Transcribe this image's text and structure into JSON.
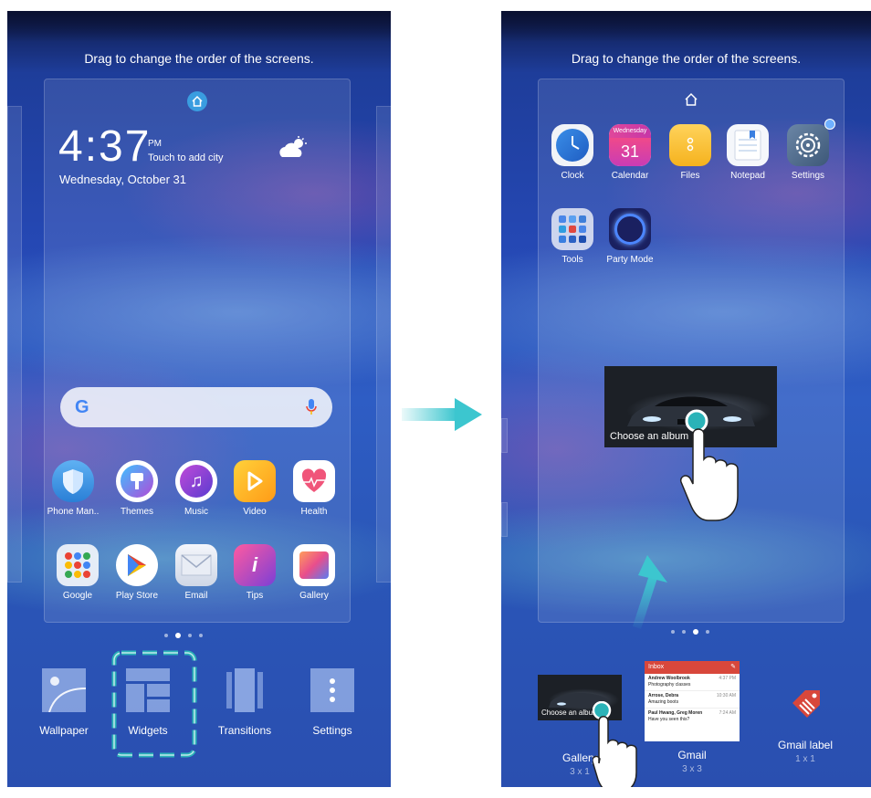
{
  "left_screen": {
    "hint": "Drag to change the order of the screens.",
    "time": "4:37",
    "ampm": "PM",
    "weather_prompt": "Touch to add city",
    "date": "Wednesday, October 31",
    "apps_row1": [
      "Phone Man..",
      "Themes",
      "Music",
      "Video",
      "Health"
    ],
    "apps_row2": [
      "Google",
      "Play Store",
      "Email",
      "Tips",
      "Gallery"
    ],
    "options": [
      "Wallpaper",
      "Widgets",
      "Transitions",
      "Settings"
    ]
  },
  "right_screen": {
    "hint": "Drag to change the order of the screens.",
    "apps_row1": [
      "Clock",
      "Calendar",
      "Files",
      "Notepad",
      "Settings"
    ],
    "calendar_day": "Wednesday",
    "calendar_date": "31",
    "apps_row2": [
      "Tools",
      "Party Mode"
    ],
    "album_widget_text": "Choose an album",
    "widgets": [
      {
        "label": "Gallery",
        "size": "3 x 1",
        "preview_text": "Choose an album"
      },
      {
        "label": "Gmail",
        "size": "3 x 3",
        "preview_title": "Inbox"
      },
      {
        "label": "Gmail label",
        "size": "1 x 1"
      }
    ],
    "gmail_preview_rows": [
      {
        "from": "Andrew Woolbrook",
        "subject": "Photography classes",
        "time": "4:37 PM"
      },
      {
        "from": "Arrose, Debra",
        "subject": "Amazing boots",
        "time": "10:30 AM"
      },
      {
        "from": "Paul Hwang, Greg Moren",
        "subject": "Have you seen this?",
        "time": "7:24 AM"
      }
    ]
  },
  "colors": {
    "accent_teal": "#2bb3b8",
    "arrow_teal": "#3cc6cf",
    "gmail_red": "#d8473b"
  }
}
